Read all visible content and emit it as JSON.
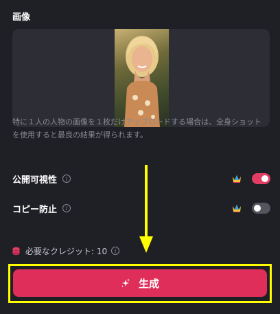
{
  "image_section": {
    "title": "画像",
    "hint": "特に１人の人物の画像を１枚だけアップロードする場合は、全身ショットを使用すると最良の結果が得られます。"
  },
  "settings": [
    {
      "label": "公開可視性",
      "premium_icon": "crown-icon",
      "enabled": true
    },
    {
      "label": "コピー防止",
      "premium_icon": "crown-icon",
      "enabled": false
    }
  ],
  "credits": {
    "text": "必要なクレジット: 10",
    "icon": "coin-stack-icon"
  },
  "generate_button": {
    "label": "生成",
    "icon": "sparkle-icon"
  },
  "annotation": {
    "arrow_color": "#ffff00",
    "highlight_color": "#ffff00"
  },
  "colors": {
    "accent": "#df2e5a",
    "background": "#1f1f26",
    "panel": "#2d2d36"
  }
}
